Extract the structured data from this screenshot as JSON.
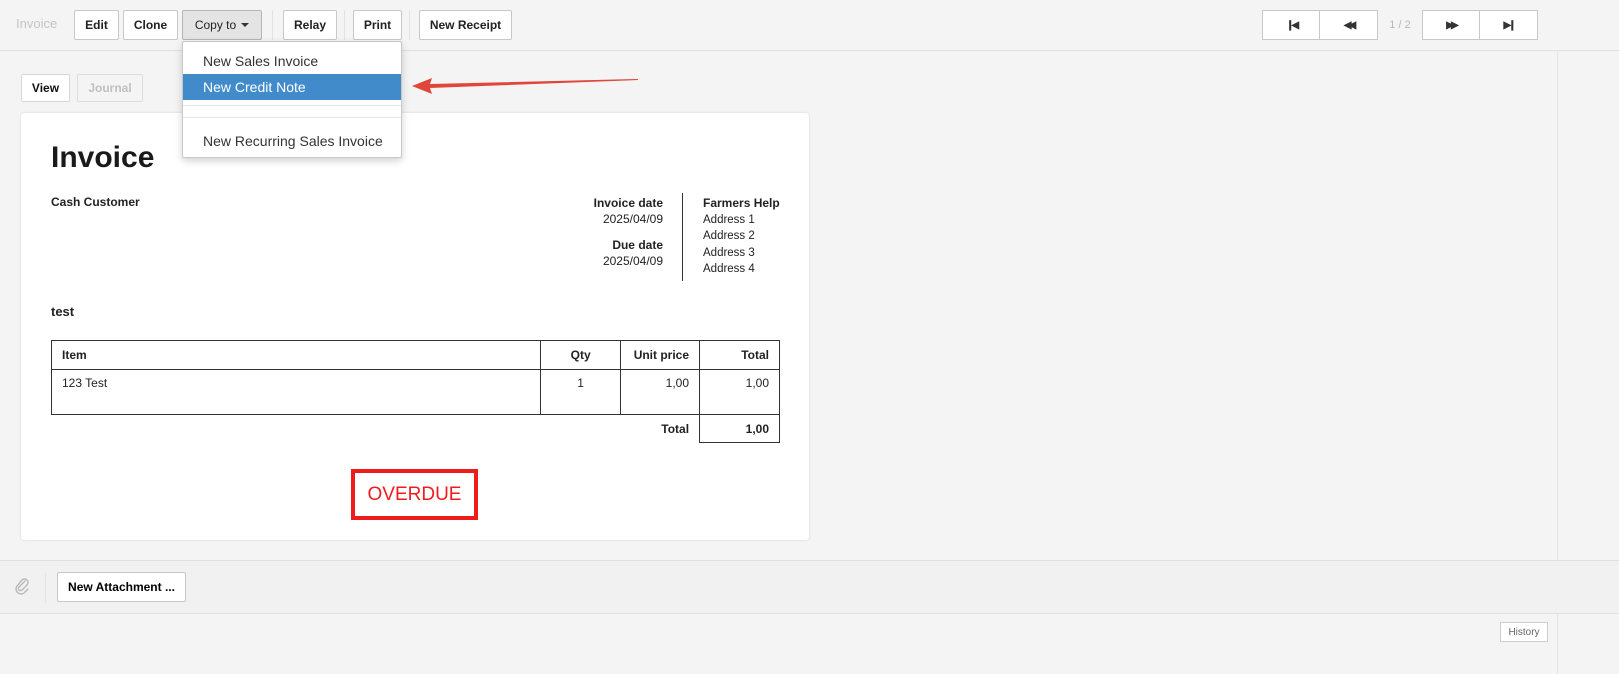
{
  "toolbar": {
    "title": "Invoice",
    "edit": "Edit",
    "clone": "Clone",
    "copy_to": "Copy to",
    "relay": "Relay",
    "print": "Print",
    "new_receipt": "New Receipt",
    "page_indicator": "1 / 2",
    "nav_icons": [
      "first-icon",
      "previous-icon",
      "next-icon",
      "last-icon"
    ]
  },
  "dropdown": {
    "items": [
      "New Sales Invoice",
      "New Credit Note",
      "New Recurring Sales Invoice"
    ],
    "highlighted": "New Credit Note"
  },
  "tabs": {
    "view": "View",
    "journal": "Journal"
  },
  "invoice": {
    "title": "Invoice",
    "customer": "Cash Customer",
    "invoice_date_label": "Invoice date",
    "invoice_date": "2025/04/09",
    "due_date_label": "Due date",
    "due_date": "2025/04/09",
    "company": {
      "name": "Farmers Help",
      "address": [
        "Address 1",
        "Address 2",
        "Address 3",
        "Address 4"
      ]
    },
    "description": "test",
    "table": {
      "headers": [
        "Item",
        "Qty",
        "Unit price",
        "Total"
      ],
      "rows": [
        [
          "123 Test",
          "1",
          "1,00",
          "1,00"
        ]
      ],
      "total_label": "Total",
      "total_value": "1,00"
    },
    "status": "OVERDUE"
  },
  "attachments": {
    "new_attachment": "New Attachment ..."
  },
  "footer": {
    "history": "History"
  },
  "colors": {
    "highlight": "#428bca",
    "overdue": "#ee1c1c",
    "arrow": "#e0463a"
  }
}
